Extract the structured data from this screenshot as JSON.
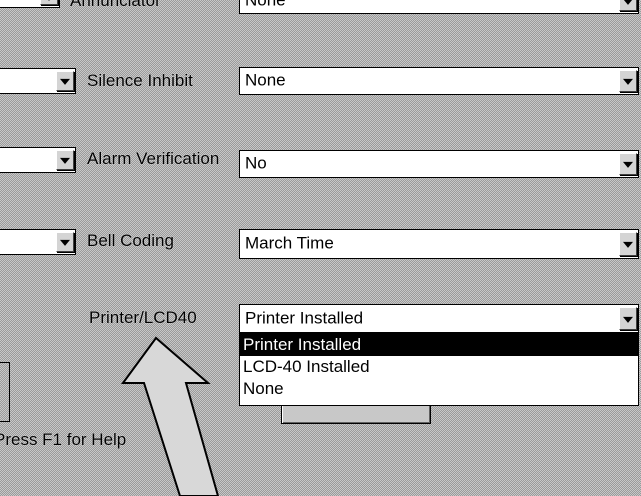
{
  "top_row": {
    "label": "Annunciator",
    "value": "None"
  },
  "rows": [
    {
      "label": "Silence Inhibit",
      "value": "None"
    },
    {
      "label": "Alarm Verification",
      "value": "No"
    },
    {
      "label": "Bell Coding",
      "value": "March Time"
    },
    {
      "label": "Printer/LCD40",
      "value": "Printer Installed"
    }
  ],
  "dropdown": {
    "options": [
      "Printer Installed",
      "LCD-40 Installed",
      "None"
    ],
    "selected": "Printer Installed"
  },
  "status": {
    "help_text": "Press F1 for Help"
  },
  "annotation": {
    "type": "callout-arrow",
    "color": "#000000"
  }
}
